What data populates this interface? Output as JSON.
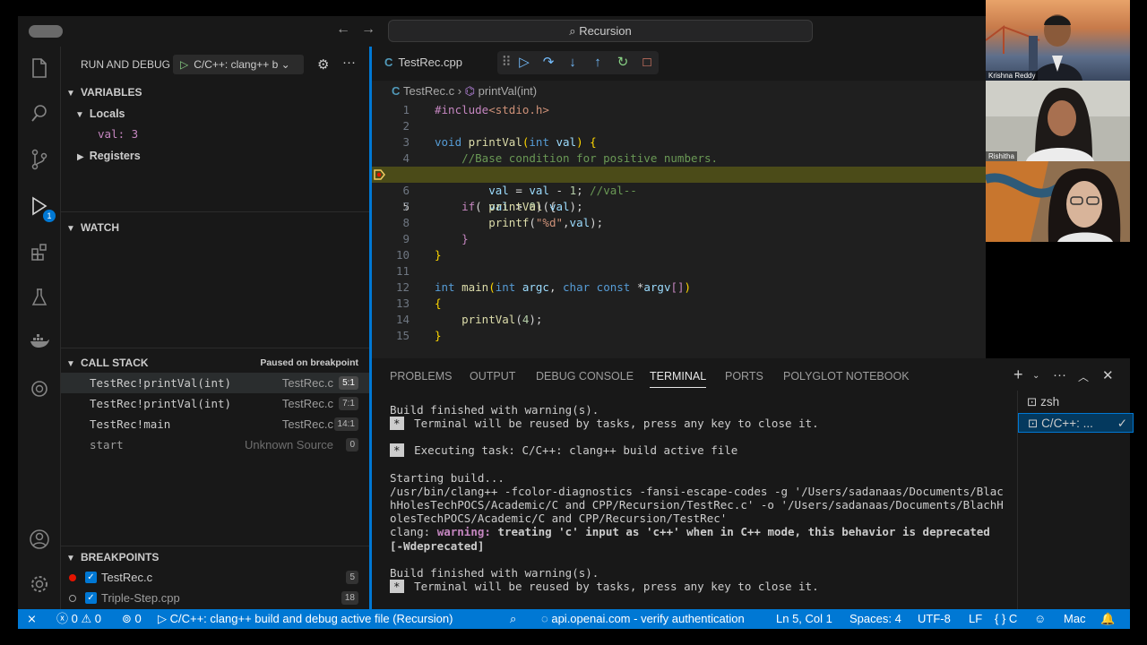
{
  "titlebar": {
    "search_text": "Recursion",
    "back_icon": "arrow-left-icon",
    "forward_icon": "arrow-right-icon"
  },
  "activity": {
    "debug_badge": "1"
  },
  "sidebar": {
    "title": "RUN AND DEBUG",
    "launch_config": "C/C++: clang++ b",
    "variables": {
      "header": "VARIABLES",
      "locals_label": "Locals",
      "local_var": "val: 3",
      "registers_label": "Registers"
    },
    "watch": {
      "header": "WATCH"
    },
    "call_stack": {
      "header": "CALL STACK",
      "status": "Paused on breakpoint",
      "frames": [
        {
          "fn": "TestRec!printVal(int)",
          "file": "TestRec.c",
          "pos": "5:1"
        },
        {
          "fn": "TestRec!printVal(int)",
          "file": "TestRec.c",
          "pos": "7:1"
        },
        {
          "fn": "TestRec!main",
          "file": "TestRec.c",
          "pos": "14:1"
        },
        {
          "fn": "start",
          "file": "Unknown Source",
          "pos": "0"
        }
      ]
    },
    "breakpoints": {
      "header": "BREAKPOINTS",
      "items": [
        {
          "name": "TestRec.c",
          "count": "5"
        },
        {
          "name": "Triple-Step.cpp",
          "count": "18"
        }
      ]
    }
  },
  "editor": {
    "tab_label": "TestRec.cpp",
    "breadcrumb_file": "TestRec.c",
    "breadcrumb_symbol": "printVal(int)",
    "line_numbers": [
      "1",
      "2",
      "3",
      "4",
      "5",
      "6",
      "7",
      "8",
      "9",
      "10",
      "11",
      "12",
      "13",
      "14",
      "15"
    ]
  },
  "panel": {
    "tabs": [
      "PROBLEMS",
      "OUTPUT",
      "DEBUG CONSOLE",
      "TERMINAL",
      "PORTS",
      "POLYGLOT NOTEBOOK"
    ],
    "active_tab": "TERMINAL",
    "terminal_lines": {
      "l1": "Build finished with warning(s).",
      "l2": "Terminal will be reused by tasks, press any key to close it.",
      "l3": "Executing task: C/C++: clang++ build active file",
      "l4": "Starting build...",
      "l5": "/usr/bin/clang++ -fcolor-diagnostics -fansi-escape-codes -g '/Users/sadanaas/Documents/BlachHolesTechPOCS/Academic/C and CPP/Recursion/TestRec.c' -o '/Users/sadanaas/Documents/BlachHolesTechPOCS/Academic/C and CPP/Recursion/TestRec'",
      "l6a": "clang: ",
      "l6b": "warning: ",
      "l6c": "treating 'c' input as 'c++' when in C++ mode, this behavior is deprecated [-Wdeprecated]",
      "l7": "Build finished with warning(s).",
      "l8": "Terminal will be reused by tasks, press any key to close it.",
      "star": "*"
    },
    "terminal_list": [
      {
        "name": "zsh"
      },
      {
        "name": "C/C++: ..."
      }
    ]
  },
  "status_bar": {
    "errors": "0",
    "warnings": "0",
    "ports": "0",
    "debug_target": "C/C++: clang++ build and debug active file (Recursion)",
    "auth": "api.openai.com - verify authentication",
    "position": "Ln 5, Col 1",
    "spaces": "Spaces: 4",
    "encoding": "UTF-8",
    "eol": "LF",
    "language": "C",
    "platform": "Mac"
  },
  "participants": [
    {
      "name": "Krishna Reddy"
    },
    {
      "name": "Rishitha"
    },
    {
      "name": ""
    }
  ],
  "colors": {
    "accent": "#0078d4",
    "current_line": "#4b4b18",
    "breakpoint": "#e51400"
  }
}
